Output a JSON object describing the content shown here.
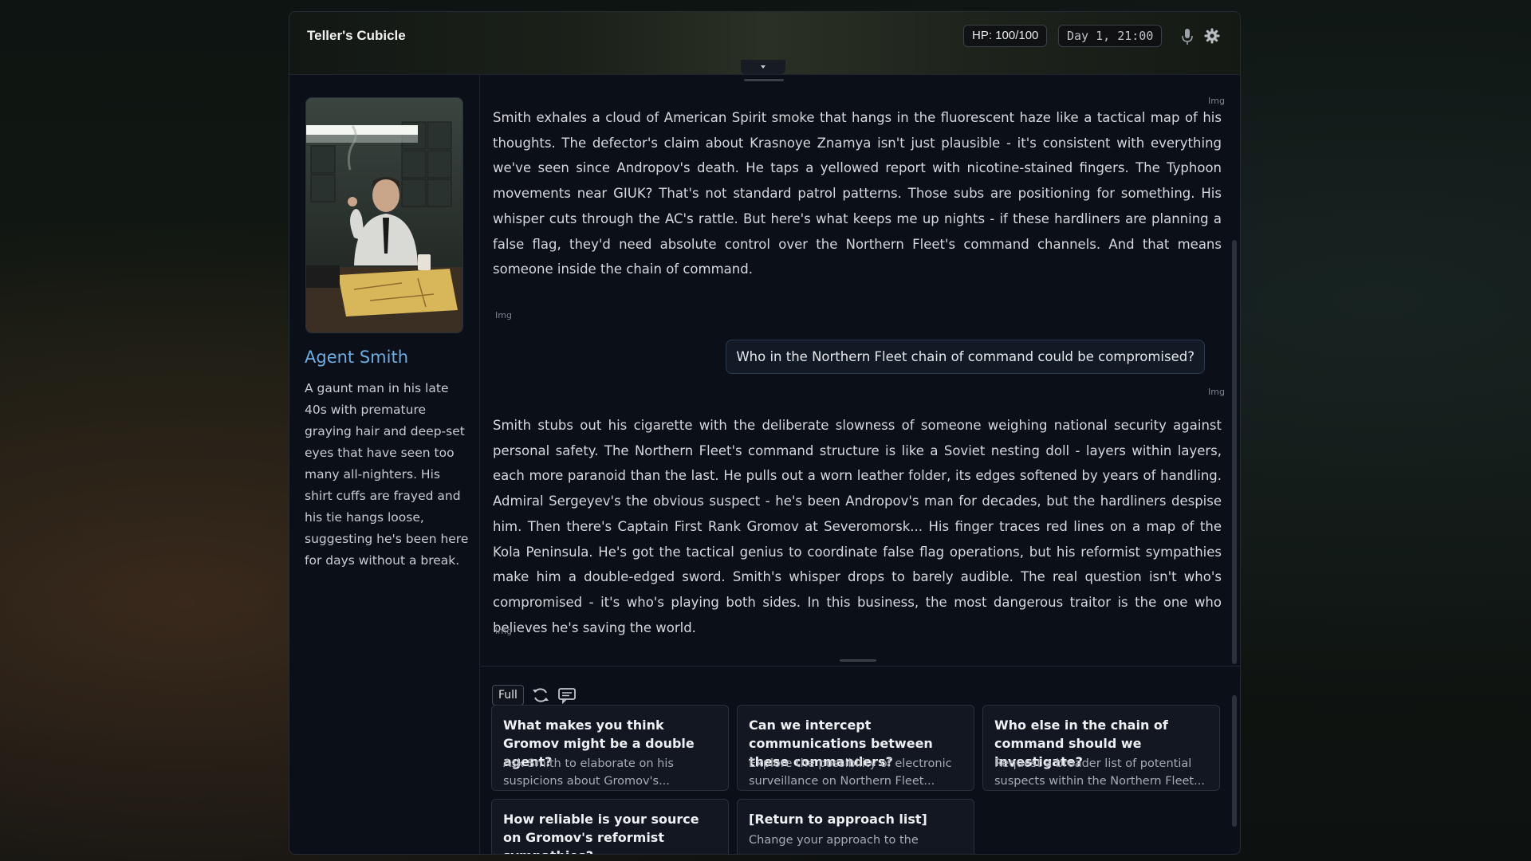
{
  "header": {
    "title": "Teller's Cubicle",
    "hp": "HP: 100/100",
    "day_time": "Day 1, 21:00",
    "icons": [
      "microphone-icon",
      "gear-icon",
      "chevron-down-icon"
    ]
  },
  "character": {
    "name": "Agent Smith",
    "description": "A gaunt man in his late 40s with premature graying hair and deep-set eyes that have seen too many all-nighters. His shirt cuffs are frayed and his tie hangs loose, suggesting he's been here for days without a break."
  },
  "chat": {
    "img_tag": "Img",
    "messages": [
      {
        "role": "npc",
        "text": "Smith exhales a cloud of American Spirit smoke that hangs in the fluorescent haze like a tactical map of his thoughts. The defector's claim about Krasnoye Znamya isn't just plausible - it's consistent with everything we've seen since Andropov's death. He taps a yellowed report with nicotine-stained fingers. The Typhoon movements near GIUK? That's not standard patrol patterns. Those subs are positioning for something. His whisper cuts through the AC's rattle. But here's what keeps me up nights - if these hardliners are planning a false flag, they'd need absolute control over the Northern Fleet's command channels. And that means someone inside the chain of command."
      },
      {
        "role": "user",
        "text": "Who in the Northern Fleet chain of command could be compromised?"
      },
      {
        "role": "npc",
        "text": "Smith stubs out his cigarette with the deliberate slowness of someone weighing national security against personal safety. The Northern Fleet's command structure is like a Soviet nesting doll - layers within layers, each more paranoid than the last. He pulls out a worn leather folder, its edges softened by years of handling. Admiral Sergeyev's the obvious suspect - he's been Andropov's man for decades, but the hardliners despise him. Then there's Captain First Rank Gromov at Severomorsk... His finger traces red lines on a map of the Kola Peninsula. He's got the tactical genius to coordinate false flag operations, but his reformist sympathies make him a double-edged sword. Smith's whisper drops to barely audible. The real question isn't who's compromised - it's who's playing both sides. In this business, the most dangerous traitor is the one who believes he's saving the world."
      }
    ]
  },
  "toolbar": {
    "full_label": "Full",
    "icons": [
      "refresh-icon",
      "chat-icon"
    ]
  },
  "options": [
    {
      "title": "What makes you think Gromov might be a double agent?",
      "desc": "Ask Smith to elaborate on his suspicions about Gromov's..."
    },
    {
      "title": "Can we intercept communications between these commanders?",
      "desc": "Explore the possibility of electronic surveillance on Northern Fleet..."
    },
    {
      "title": "Who else in the chain of command should we investigate?",
      "desc": "Request a broader list of potential suspects within the Northern Fleet..."
    },
    {
      "title": "How reliable is your source on Gromov's reformist sympathies?",
      "desc": ""
    },
    {
      "title": "[Return to approach list]",
      "desc": "Change your approach to the"
    }
  ],
  "colors": {
    "accent": "#6aaee4",
    "panel": "#0b0f18",
    "card": "#121722"
  }
}
